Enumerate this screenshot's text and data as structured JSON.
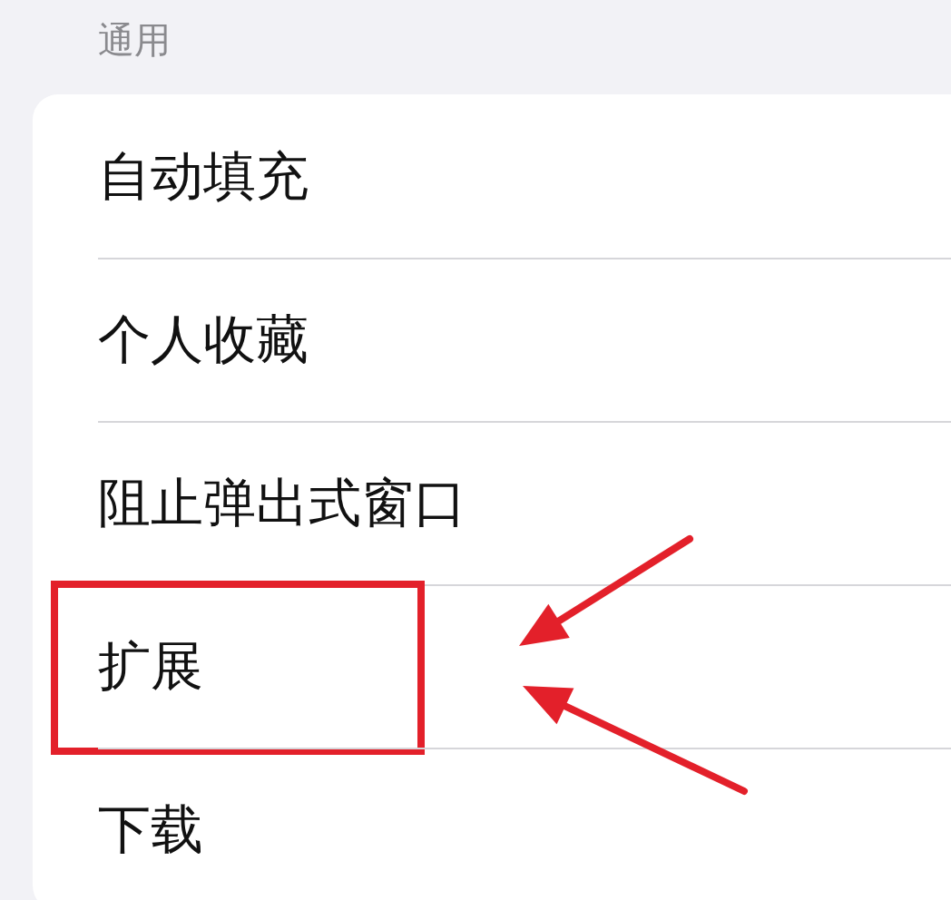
{
  "section_header": "通用",
  "rows": [
    {
      "label": "自动填充",
      "highlighted": false
    },
    {
      "label": "个人收藏",
      "highlighted": false
    },
    {
      "label": "阻止弹出式窗口",
      "highlighted": false
    },
    {
      "label": "扩展",
      "highlighted": true
    },
    {
      "label": "下载",
      "highlighted": false
    }
  ],
  "arrows": [
    {
      "kind": "arrow"
    },
    {
      "kind": "arrow"
    }
  ]
}
